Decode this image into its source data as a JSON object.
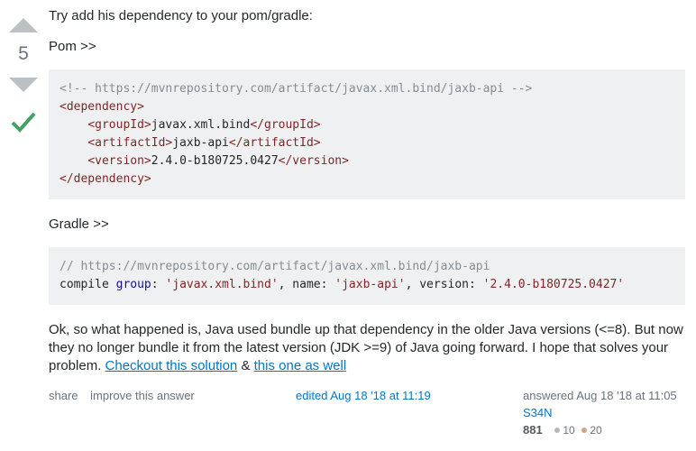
{
  "vote": {
    "count": "5"
  },
  "post": {
    "intro": "Try add his dependency to your pom/gradle:",
    "pom_label": "Pom >>",
    "pom_code": {
      "c": "<!-- https://mvnrepository.com/artifact/javax.xml.bind/jaxb-api -->",
      "open_dep": "<dependency>",
      "g_open": "<groupId>",
      "g_val": "javax.xml.bind",
      "g_close": "</groupId>",
      "a_open": "<artifactId>",
      "a_val": "jaxb-api",
      "a_close": "</artifactId>",
      "v_open": "<version>",
      "v_val": "2.4.0-b180725.0427",
      "v_close": "</version>",
      "close_dep": "</dependency>"
    },
    "gradle_label": "Gradle >>",
    "gradle_code": {
      "c": "// https://mvnrepository.com/artifact/javax.xml.bind/jaxb-api",
      "l2a": "compile ",
      "l2b": "group",
      "l2c": ": ",
      "l2d": "'javax.xml.bind'",
      "l2e": ", name: ",
      "l2f": "'jaxb-api'",
      "l2g": ", version: ",
      "l2h": "'2.4.0-b180725.0427'"
    },
    "expl1": "Ok, so what happened is, Java used bundle up that dependency in the older Java versions (<=8). But now they no longer bundle it from the latest version (JDK >=9) of Java going forward. I hope that solves your problem. ",
    "link1": "Checkout this solution",
    "amp": " & ",
    "link2": "this one as well"
  },
  "footer": {
    "share": "share",
    "improve": "improve this answer",
    "edited": "edited Aug 18 '18 at 11:19",
    "answered": "answered Aug 18 '18 at 11:05",
    "user": "S34N",
    "rep": "881",
    "silver": "10",
    "bronze": "20"
  }
}
